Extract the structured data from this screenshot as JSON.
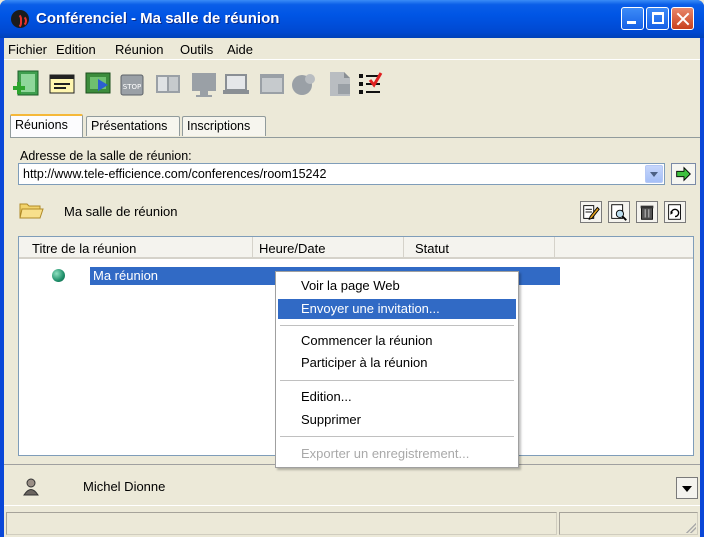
{
  "window": {
    "title": "Conférenciel - Ma salle de réunion",
    "title_color": "#0055e5"
  },
  "menu": [
    {
      "label": "Fichier"
    },
    {
      "label": "Edition"
    },
    {
      "label": "Réunion"
    },
    {
      "label": "Outils"
    },
    {
      "label": "Aide"
    }
  ],
  "toolbar": {
    "icons": [
      "new-meeting-icon",
      "properties-icon",
      "start-presentation-icon",
      "stop-icon",
      "panel-icon",
      "monitor-icon",
      "laptop-icon",
      "window-icon",
      "share-icon",
      "document-icon",
      "checklist-icon"
    ]
  },
  "tabs": [
    {
      "label": "Réunions",
      "active": true
    },
    {
      "label": "Présentations",
      "active": false
    },
    {
      "label": "Inscriptions",
      "active": false
    }
  ],
  "address": {
    "label": "Adresse de la salle de réunion:",
    "value": "http://www.tele-efficience.com/conferences/room15242"
  },
  "room": {
    "name": "Ma salle de réunion",
    "actions": [
      "edit-icon",
      "preview-icon",
      "delete-icon",
      "refresh-icon"
    ]
  },
  "meetings": {
    "columns": [
      "Titre de la réunion",
      "Heure/Date",
      "Statut"
    ],
    "rows": [
      {
        "title": "Ma réunion",
        "status_color": "#1f8f6a",
        "selected": true
      }
    ]
  },
  "context_menu": {
    "items": [
      {
        "label": "Voir la page Web"
      },
      {
        "label": "Envoyer une invitation..."
      },
      {
        "label": "Commencer la réunion"
      },
      {
        "label": "Participer à la réunion"
      },
      {
        "label": "Edition..."
      },
      {
        "label": "Supprimer"
      },
      {
        "label": "Exporter un enregistrement..."
      }
    ],
    "highlight_color": "#316ac5"
  },
  "user": {
    "name": "Michel Dionne"
  }
}
